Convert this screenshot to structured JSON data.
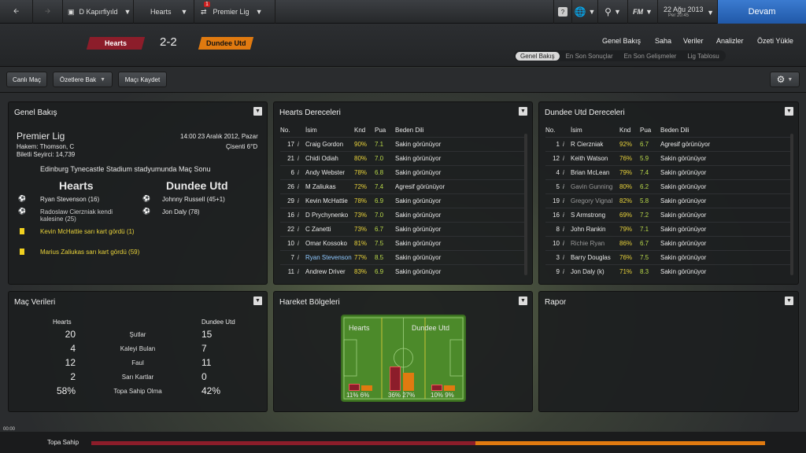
{
  "topbar": {
    "crumb1": "D Kapırfiyıld",
    "crumb2": "Hearts",
    "crumb3": "Premier Lig",
    "badge": "1",
    "date": "22 Ağu 2013",
    "day": "Per 20:45",
    "fm": "FM",
    "help": "?",
    "devam": "Devam"
  },
  "match": {
    "home": "Hearts",
    "away": "Dundee Utd",
    "score": "2-2",
    "home_color": "#8c1d2a",
    "away_color": "#e07a10"
  },
  "nav": [
    "Genel Bakış",
    "Saha",
    "Veriler",
    "Analizler",
    "Özeti Yükle"
  ],
  "subtabs": [
    "Genel Bakış",
    "En Son Sonuçlar",
    "En Son Gelişmeler",
    "Lig Tablosu"
  ],
  "toolbar": {
    "b1": "Canlı Maç",
    "b2": "Özetlere Bak",
    "b3": "Maçı Kaydet"
  },
  "overview": {
    "title": "Genel Bakış",
    "league": "Premier Lig",
    "datetime": "14:00 23 Aralık 2012, Pazar",
    "ref": "Hakem: Thomson, C",
    "weather": "Çisenti 6°D",
    "att": "Biletli Seyirci: 14,739",
    "stadium": "Edinburg Tynecastle Stadium stadyumunda Maç Sonu",
    "home": "Hearts",
    "away": "Dundee Utd",
    "hg1": "Ryan Stevenson (16)",
    "hg2": "Radoslaw Cierzniak kendi kalesine (25)",
    "hy1": "Kevin McHattie sarı kart gördü (1)",
    "hy2": "Marius Zaliukas sarı kart gördü (59)",
    "ag1": "Johnny Russell (45+1)",
    "ag2": "Jon Daly (78)"
  },
  "hearts_ratings": {
    "title": "Hearts Dereceleri",
    "cols": [
      "No.",
      "İsim",
      "Knd",
      "Pua",
      "Beden Dili"
    ],
    "rows": [
      [
        "17",
        "Craig Gordon",
        "90%",
        "7.1",
        "Sakin görünüyor"
      ],
      [
        "21",
        "Chidi Odiah",
        "80%",
        "7.0",
        "Sakin görünüyor"
      ],
      [
        "6",
        "Andy Webster",
        "78%",
        "6.8",
        "Sakin görünüyor"
      ],
      [
        "26",
        "M Zaliukas",
        "72%",
        "7.4",
        "Agresif görünüyor"
      ],
      [
        "29",
        "Kevin McHattie",
        "78%",
        "6.9",
        "Sakin görünüyor"
      ],
      [
        "16",
        "D Prychynenko",
        "73%",
        "7.0",
        "Sakin görünüyor"
      ],
      [
        "22",
        "C Zanetti",
        "73%",
        "6.7",
        "Sakin görünüyor"
      ],
      [
        "10",
        "Omar Kossoko",
        "81%",
        "7.5",
        "Sakin görünüyor"
      ],
      [
        "7",
        "Ryan Stevenson",
        "77%",
        "8.5",
        "Sakin görünüyor"
      ],
      [
        "11",
        "Andrew Driver",
        "83%",
        "6.9",
        "Sakin görünüyor"
      ]
    ]
  },
  "dundee_ratings": {
    "title": "Dundee Utd Dereceleri",
    "cols": [
      "No.",
      "İsim",
      "Knd",
      "Pua",
      "Beden Dili"
    ],
    "rows": [
      [
        "1",
        "R Cierzniak",
        "92%",
        "6.7",
        "Agresif görünüyor"
      ],
      [
        "12",
        "Keith Watson",
        "76%",
        "5.9",
        "Sakin görünüyor"
      ],
      [
        "4",
        "Brian McLean",
        "79%",
        "7.4",
        "Sakin görünüyor"
      ],
      [
        "5",
        "Gavin Gunning",
        "80%",
        "6.2",
        "Sakin görünüyor"
      ],
      [
        "19",
        "Gregory Vignal",
        "82%",
        "5.8",
        "Sakin görünüyor"
      ],
      [
        "16",
        "S Armstrong",
        "69%",
        "7.2",
        "Sakin görünüyor"
      ],
      [
        "8",
        "John Rankin",
        "79%",
        "7.1",
        "Sakin görünüyor"
      ],
      [
        "10",
        "Richie Ryan",
        "86%",
        "6.7",
        "Sakin görünüyor"
      ],
      [
        "3",
        "Barry Douglas",
        "76%",
        "7.5",
        "Sakin görünüyor"
      ],
      [
        "9",
        "Jon Daly (k)",
        "71%",
        "8.3",
        "Sakin görünüyor"
      ]
    ]
  },
  "stats": {
    "title": "Maç Verileri",
    "home": "Hearts",
    "away": "Dundee Utd",
    "rows": [
      [
        "20",
        "Şutlar",
        "15"
      ],
      [
        "4",
        "Kaleyi Bulan",
        "7"
      ],
      [
        "12",
        "Faul",
        "11"
      ],
      [
        "2",
        "Sarı Kartlar",
        "0"
      ],
      [
        "58%",
        "Topa Sahip Olma",
        "42%"
      ]
    ]
  },
  "zones": {
    "title": "Hareket Bölgeleri",
    "home": "Hearts",
    "away": "Dundee Utd",
    "p1": "11% 6%",
    "p2": "36% 27%",
    "p3": "10% 9%"
  },
  "report": {
    "title": "Rapor"
  },
  "bottom": {
    "time": "00:00",
    "label": "Topa Sahip"
  }
}
